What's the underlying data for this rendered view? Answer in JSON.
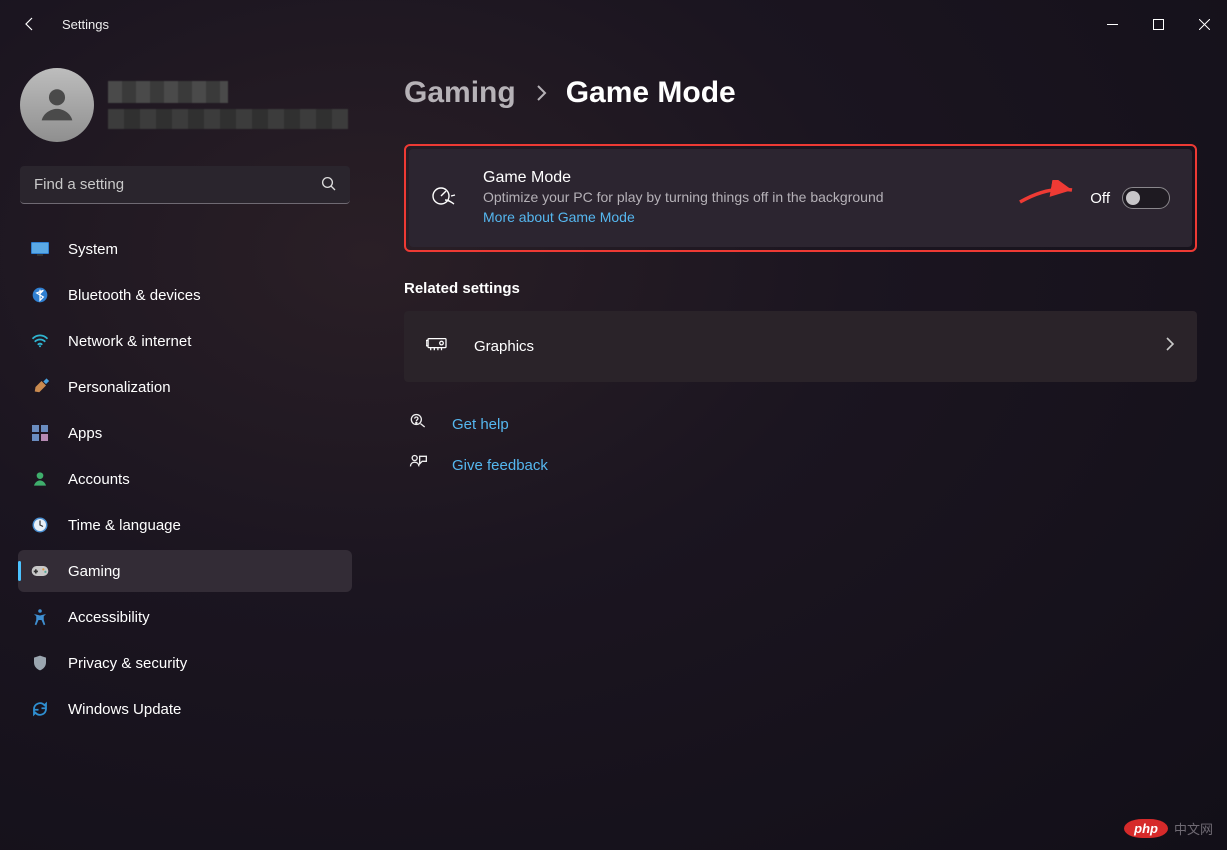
{
  "titlebar": {
    "app_name": "Settings"
  },
  "search": {
    "placeholder": "Find a setting"
  },
  "sidebar": {
    "items": [
      {
        "label": "System",
        "icon": "monitor"
      },
      {
        "label": "Bluetooth & devices",
        "icon": "bluetooth"
      },
      {
        "label": "Network & internet",
        "icon": "wifi"
      },
      {
        "label": "Personalization",
        "icon": "brush"
      },
      {
        "label": "Apps",
        "icon": "apps"
      },
      {
        "label": "Accounts",
        "icon": "person"
      },
      {
        "label": "Time & language",
        "icon": "clock"
      },
      {
        "label": "Gaming",
        "icon": "gamepad"
      },
      {
        "label": "Accessibility",
        "icon": "accessibility"
      },
      {
        "label": "Privacy & security",
        "icon": "shield"
      },
      {
        "label": "Windows Update",
        "icon": "update"
      }
    ],
    "active_index": 7
  },
  "breadcrumb": {
    "parent": "Gaming",
    "current": "Game Mode"
  },
  "game_mode_card": {
    "title": "Game Mode",
    "description": "Optimize your PC for play by turning things off in the background",
    "link": "More about Game Mode",
    "toggle_state": "Off"
  },
  "related": {
    "heading": "Related settings",
    "items": [
      {
        "label": "Graphics"
      }
    ]
  },
  "help": {
    "get_help": "Get help",
    "give_feedback": "Give feedback"
  },
  "watermark": {
    "brand": "php",
    "suffix": "中文网"
  }
}
